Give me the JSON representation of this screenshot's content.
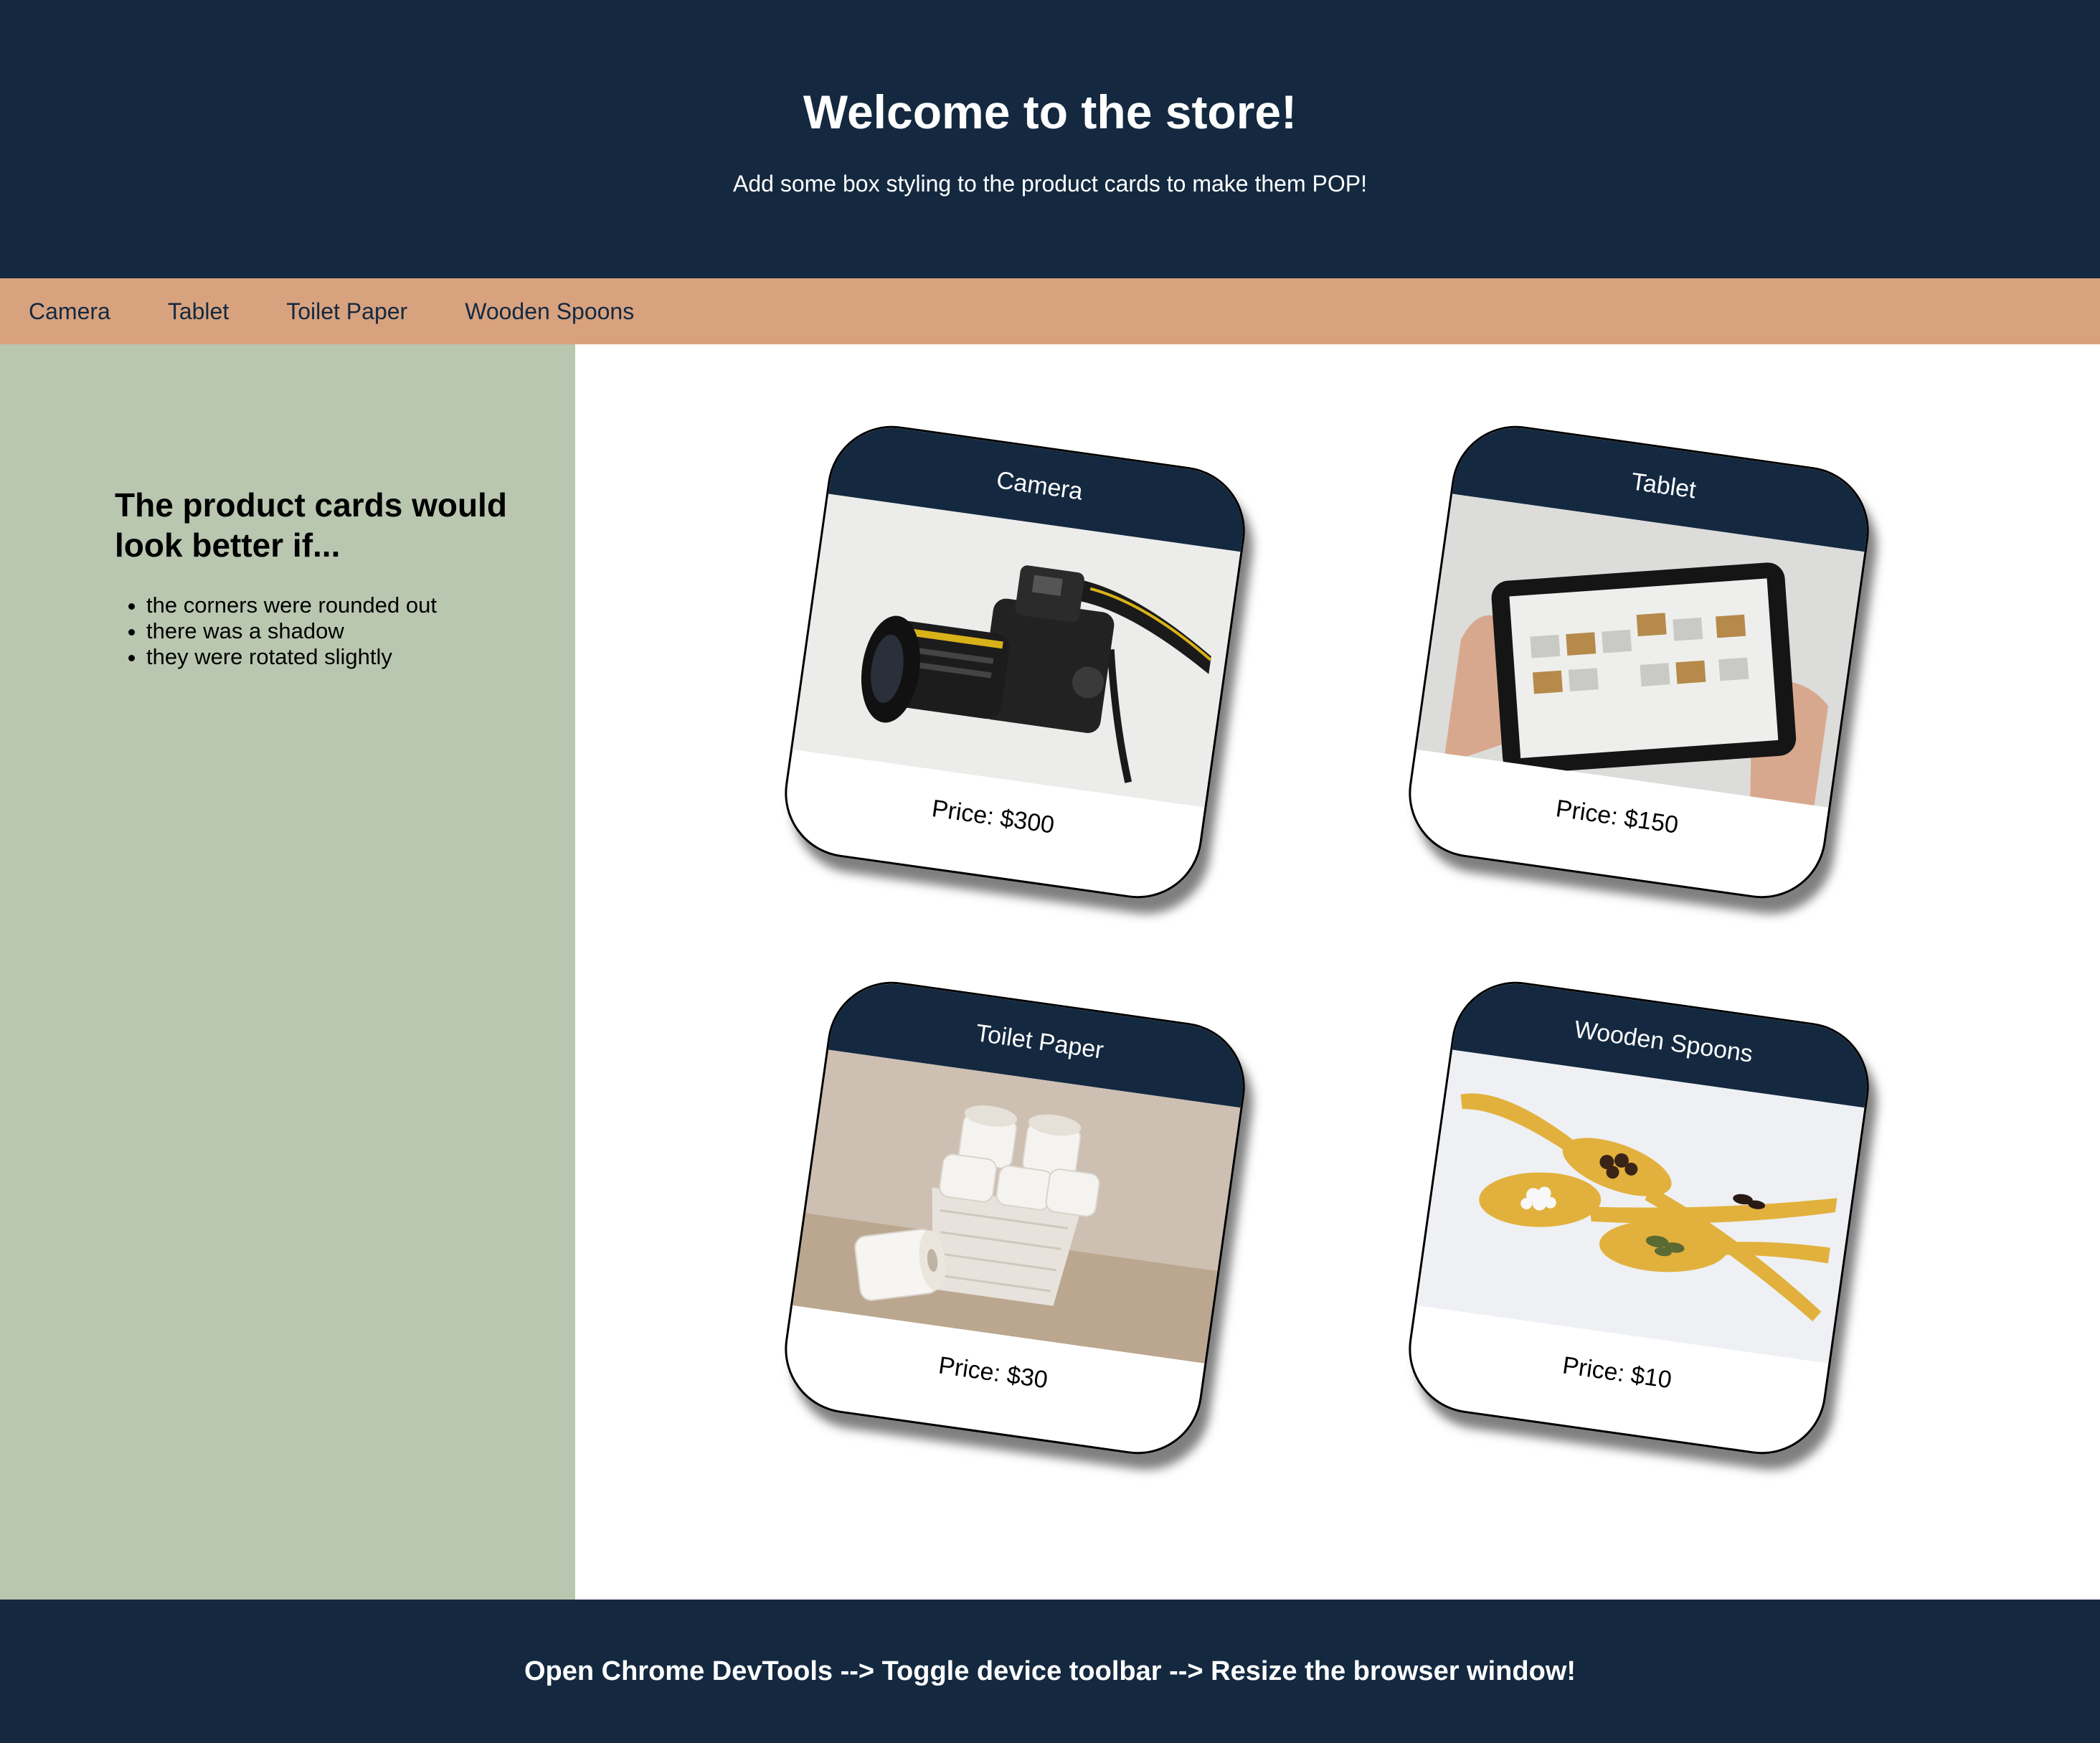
{
  "header": {
    "title": "Welcome to the store!",
    "subtitle": "Add some box styling to the product cards to make them POP!"
  },
  "nav": {
    "items": [
      "Camera",
      "Tablet",
      "Toilet Paper",
      "Wooden Spoons"
    ]
  },
  "sidebar": {
    "heading": "The product cards would look better if...",
    "items": [
      "the corners were rounded out",
      "there was a shadow",
      "they were rotated slightly"
    ]
  },
  "products": [
    {
      "title": "Camera",
      "price": "Price: $300",
      "icon": "camera-photo"
    },
    {
      "title": "Tablet",
      "price": "Price: $150",
      "icon": "tablet-photo"
    },
    {
      "title": "Toilet Paper",
      "price": "Price: $30",
      "icon": "toilet-paper-photo"
    },
    {
      "title": "Wooden Spoons",
      "price": "Price: $10",
      "icon": "wooden-spoons-photo"
    }
  ],
  "footer": {
    "text": "Open Chrome DevTools --> Toggle device toolbar --> Resize the browser window!"
  },
  "colors": {
    "navy": "#142940",
    "tan": "#d8a27f",
    "sage": "#b9c7b0"
  }
}
